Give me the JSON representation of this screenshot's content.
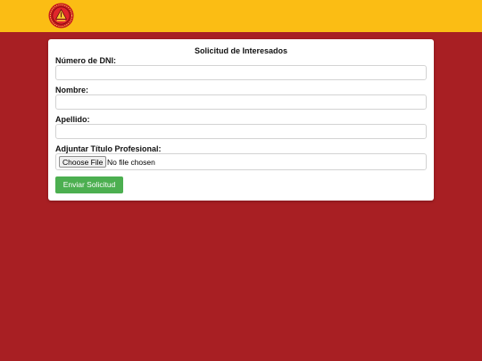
{
  "form": {
    "title": "Solicitud de Interesados",
    "fields": [
      {
        "label": "Número de DNI:",
        "value": ""
      },
      {
        "label": "Nombre:",
        "value": ""
      },
      {
        "label": "Apellido:",
        "value": ""
      }
    ],
    "file": {
      "label": "Adjuntar Título Profesional:",
      "button_label": "Choose File",
      "status": "No file chosen"
    },
    "submit_label": "Enviar Solicitud"
  },
  "colors": {
    "header": "#fbbd14",
    "background": "#a81f23",
    "submit": "#4caf50"
  }
}
